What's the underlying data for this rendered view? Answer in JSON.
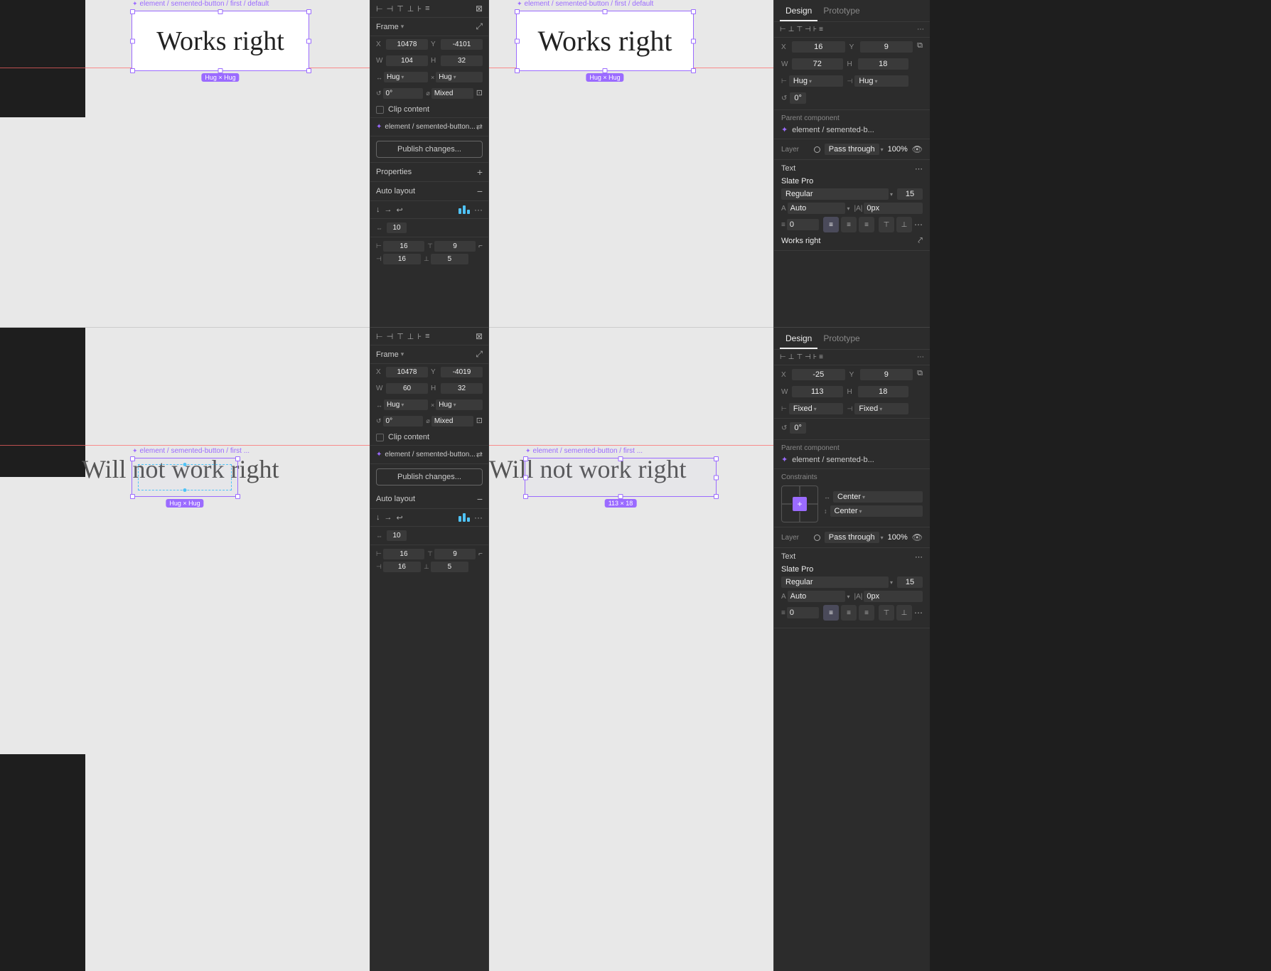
{
  "canvas": {
    "top": {
      "frame_label": "element / semented-button / first / default",
      "hug_label": "Hug × Hug",
      "works_right_text": "Works right",
      "red_guide_top_y": "35%"
    },
    "bottom": {
      "frame_label": "element / semented-button / first ...",
      "hug_label": "Hug × Hug",
      "will_not_text": "Will not work right",
      "size_label": "113 × 18"
    }
  },
  "center_panel_top": {
    "tab_frame": "Frame",
    "x_label": "X",
    "x_value": "10478",
    "y_label": "Y",
    "y_value": "-4101",
    "w_label": "W",
    "w_value": "104",
    "h_label": "H",
    "h_value": "32",
    "hug_x": "Hug",
    "hug_y": "Hug",
    "rotation_label": "0°",
    "clip_content": "Clip content",
    "component_label": "element / semented-button...",
    "publish_btn": "Publish changes...",
    "properties_label": "Properties",
    "auto_layout_label": "Auto layout",
    "al_gap": "10",
    "al_pad_left": "16",
    "al_pad_top": "9",
    "al_pad_right": "16",
    "al_pad_bottom": "5"
  },
  "center_panel_bottom": {
    "tab_frame": "Frame",
    "x_value": "10478",
    "y_value": "-4019",
    "w_value": "60",
    "h_value": "32",
    "hug_x": "Hug",
    "hug_y": "Hug",
    "rotation_label": "0°",
    "clip_content": "Clip content",
    "component_label": "element / semented-button...",
    "publish_btn": "Publish changes...",
    "auto_layout_label": "Auto layout",
    "al_gap": "10",
    "al_pad_left": "16",
    "al_pad_top": "9",
    "al_pad_right": "16",
    "al_pad_bottom": "5"
  },
  "right_panel_top": {
    "tab_design": "Design",
    "tab_prototype": "Prototype",
    "x_value": "16",
    "y_value": "9",
    "w_value": "72",
    "h_value": "18",
    "hug_w": "Hug",
    "hug_h": "Hug",
    "rotation": "0°",
    "parent_component_label": "Parent component",
    "parent_component_name": "element / semented-b...",
    "layer_label": "Layer",
    "layer_mode": "Pass through",
    "layer_opacity": "100%",
    "text_label": "Text",
    "font_name": "Slate Pro",
    "font_style": "Regular",
    "font_size": "15",
    "auto_label": "Auto",
    "px_label": "0px",
    "line_height": "0",
    "text_content": "Works right"
  },
  "right_panel_bottom": {
    "tab_design": "Design",
    "tab_prototype": "Prototype",
    "x_value": "-25",
    "y_value": "9",
    "w_value": "113",
    "h_value": "18",
    "fixed_w": "Fixed",
    "fixed_h": "Fixed",
    "rotation": "0°",
    "parent_component_label": "Parent component",
    "parent_component_name": "element / semented-b...",
    "constraints_label": "Constraints",
    "center_h": "Center",
    "center_v": "Center",
    "layer_label": "Layer",
    "layer_mode": "Pass through",
    "layer_opacity": "100%",
    "text_label": "Text",
    "font_name": "Slate Pro",
    "font_style": "Regular",
    "font_size": "15",
    "auto_label": "Auto",
    "px_label": "0px",
    "line_height": "0"
  }
}
